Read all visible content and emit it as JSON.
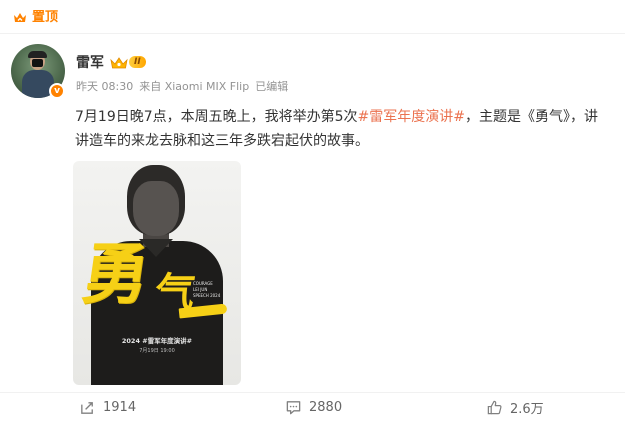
{
  "pinned": {
    "label": "置顶",
    "icon": "pin-icon",
    "color": "#ff8200"
  },
  "author": {
    "name": "雷军",
    "verified_icon": "verified-v-icon",
    "verified_mark": "v",
    "level_badge": "II",
    "time": "昨天 08:30",
    "source": "来自 Xiaomi MIX Flip",
    "edited": "已编辑"
  },
  "post": {
    "text_before": "7月19日晚7点，本周五晚上，我将举办第5次",
    "topic": "#雷军年度演讲#",
    "text_after": "，主题是《勇气》，讲讲造车的来龙去脉和这三年多跌宕起伏的故事。",
    "topic_color": "#eb7350"
  },
  "poster": {
    "big_char": "勇",
    "big_char_2": "气",
    "english_lines": [
      "COURAGE",
      "LEI JUN",
      "SPEECH 2024"
    ],
    "event_line": "2024 #雷军年度演讲#",
    "date_line": "7月19日 19:00",
    "accent": "#f6d016"
  },
  "actions": {
    "repost_count": "1914",
    "comment_count": "2880",
    "like_count": "2.6万"
  }
}
